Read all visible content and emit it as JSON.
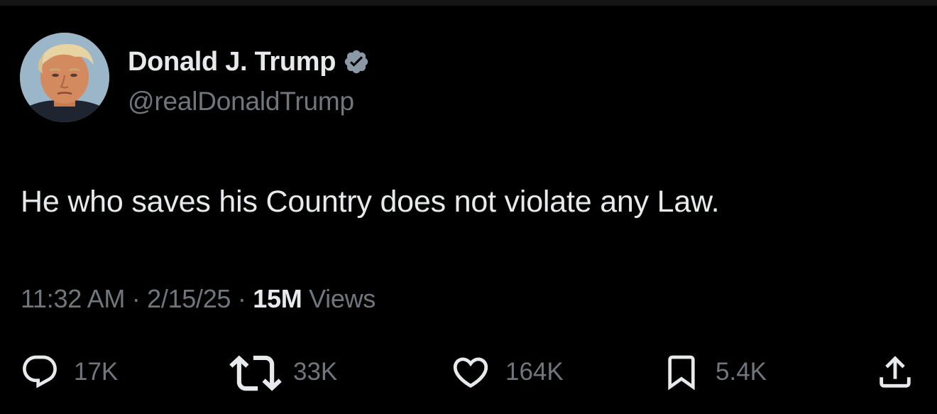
{
  "author": {
    "name": "Donald J. Trump",
    "handle": "@realDonaldTrump",
    "verified_badge_color": "#8b98a5"
  },
  "tweet": {
    "text": "He who saves his Country does not violate any Law.",
    "time": "11:32 AM",
    "separator": "·",
    "date": "2/15/25",
    "views_count": "15M",
    "views_label": "Views"
  },
  "actions": {
    "replies": {
      "icon": "reply-icon",
      "count": "17K"
    },
    "reposts": {
      "icon": "repost-icon",
      "count": "33K"
    },
    "likes": {
      "icon": "heart-icon",
      "count": "164K"
    },
    "bookmarks": {
      "icon": "bookmark-icon",
      "count": "5.4K"
    },
    "share": {
      "icon": "share-icon"
    }
  },
  "colors": {
    "background": "#000000",
    "primary_text": "#e7e9ea",
    "secondary_text": "#71767b"
  }
}
